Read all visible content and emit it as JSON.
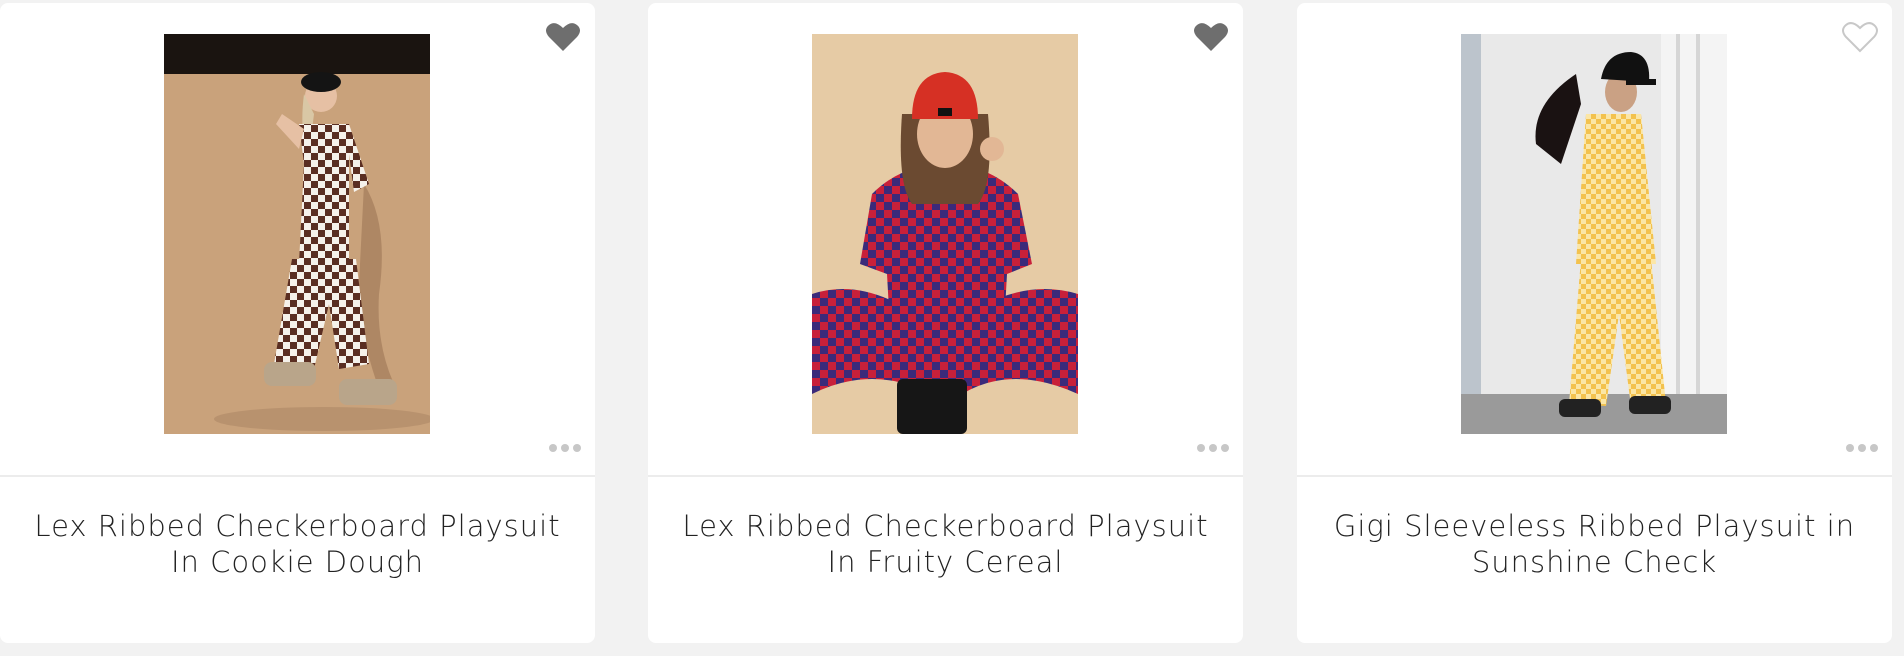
{
  "products": [
    {
      "title": "Lex Ribbed Checkerboard Playsuit In Cookie Dough",
      "favorite": true,
      "image": "model-in-brown-checkerboard-playsuit",
      "colors": {
        "background": "#c9a27b",
        "check_a": "#5a2e22",
        "check_b": "#f5f1ea"
      }
    },
    {
      "title": "Lex Ribbed Checkerboard Playsuit In Fruity Cereal",
      "favorite": true,
      "image": "model-in-red-purple-checkerboard-playsuit",
      "colors": {
        "background": "#e6cba5",
        "check_a": "#c8203a",
        "check_b": "#3b2a7a"
      }
    },
    {
      "title": "Gigi Sleeveless Ribbed Playsuit in Sunshine Check",
      "favorite": false,
      "image": "model-in-yellow-check-playsuit",
      "colors": {
        "background": "#eeeeee",
        "check_a": "#f3c24e",
        "check_b": "#fbe6a6"
      }
    }
  ],
  "icons": {
    "favorite": "heart-icon",
    "more": "more-options-icon"
  },
  "colors": {
    "heart_filled": "#6e6e6e",
    "heart_outline": "#c8c8c8",
    "dots": "#c7c7c7"
  }
}
